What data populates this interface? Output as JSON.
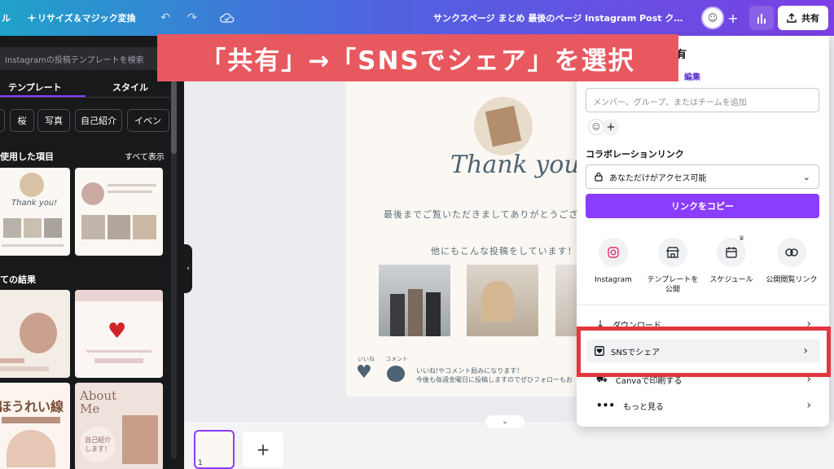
{
  "topbar": {
    "left_fragment": "ル",
    "resize_label": "リサイズ＆マジック変換",
    "doc_title": "サンクスページ まとめ 最後のページ Instagram Post クリーム…",
    "share_label": "共有"
  },
  "sidebar": {
    "search_placeholder": "Instagramの投稿テンプレートを検索",
    "tabs": [
      "テンプレート",
      "スタイル"
    ],
    "chips": [
      "桜",
      "写真",
      "自己紹介",
      "イベン"
    ],
    "recent_heading": "使用した項目",
    "see_all": "すべて表示",
    "results_heading": "ての結果",
    "thumb_texts": {
      "about": "About Me",
      "intro": "自己紹介します！",
      "wrinkle": "ほうれい線"
    }
  },
  "canvas": {
    "thank_you": "Thank you!",
    "line1": "最後までご覧いただきましてありがとうござ",
    "line2": "他にもこんな投稿をしています！",
    "like_label": "いいね",
    "comment_label": "コメント",
    "footer1": "いいね!やコメント励みになります！",
    "footer2": "今後も毎週金曜日に投稿しますのでぜひフォローもお"
  },
  "bottombar": {
    "page_number": "1",
    "add_page": "+"
  },
  "share_panel": {
    "title_fragment": "有",
    "edit_link": "編集",
    "invite_placeholder": "メンバー、グループ、またはチームを追加",
    "collab_heading": "コラボレーションリンク",
    "access_value": "あなただけがアクセス可能",
    "copy_link": "リンクをコピー",
    "actions": [
      {
        "label": "Instagram",
        "icon": "instagram-icon"
      },
      {
        "label": "テンプレートを公開",
        "icon": "store-icon"
      },
      {
        "label": "スケジュール",
        "icon": "calendar-icon"
      },
      {
        "label": "公開閲覧リンク",
        "icon": "link-icon"
      }
    ],
    "download_label": "ダウンロード",
    "sns_share_label": "SNSでシェア",
    "print_label": "Canvaで印刷する",
    "more_label": "もっと見る"
  },
  "annotation": {
    "banner_text": "「共有」→「SNSでシェア」を選択"
  },
  "colors": {
    "accent_purple": "#8b3dff",
    "banner_red": "#e8585f",
    "highlight_red": "#e2373f"
  }
}
